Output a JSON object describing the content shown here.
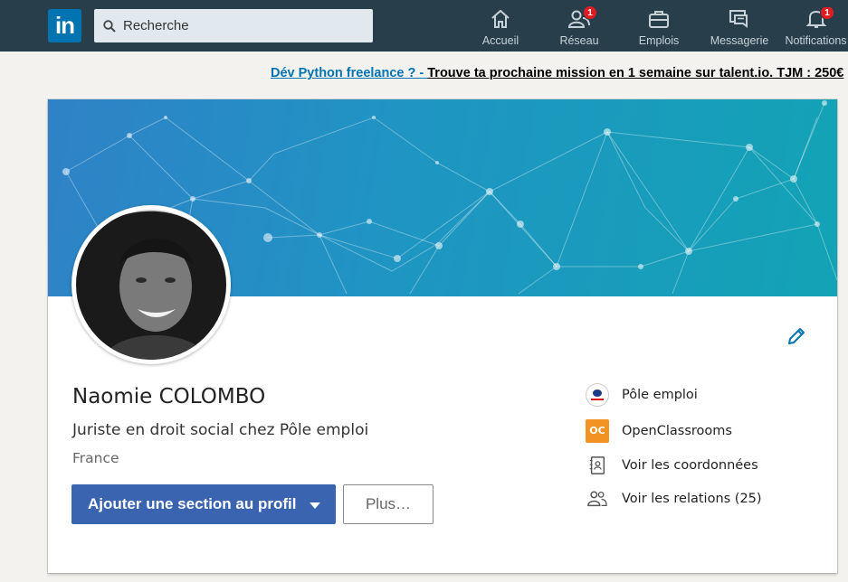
{
  "nav": {
    "logo": "in",
    "search_placeholder": "Recherche",
    "items": [
      {
        "label": "Accueil",
        "icon": "home-icon"
      },
      {
        "label": "Réseau",
        "icon": "network-icon",
        "badge": "1"
      },
      {
        "label": "Emplois",
        "icon": "briefcase-icon"
      },
      {
        "label": "Messagerie",
        "icon": "messaging-icon"
      },
      {
        "label": "Notifications",
        "icon": "bell-icon",
        "badge": "1"
      }
    ]
  },
  "ad": {
    "prefix": "Dév Python freelance ? - ",
    "text": "Trouve ta prochaine mission en 1 semaine sur talent.io. TJM : 250€"
  },
  "profile": {
    "name": "Naomie COLOMBO",
    "headline": "Juriste en droit social chez Pôle emploi",
    "location": "France",
    "primary_button": "Ajouter une section au profil",
    "secondary_button": "Plus…",
    "side": {
      "company": "Pôle emploi",
      "school": "OpenClassrooms",
      "school_logo_text": "OC",
      "contact": "Voir les coordonnées",
      "connections": "Voir les relations (25)"
    }
  },
  "colors": {
    "topbar": "#283e4a",
    "brand": "#0073b1",
    "primary_button": "#3a64b0",
    "badge": "#e01b22"
  }
}
